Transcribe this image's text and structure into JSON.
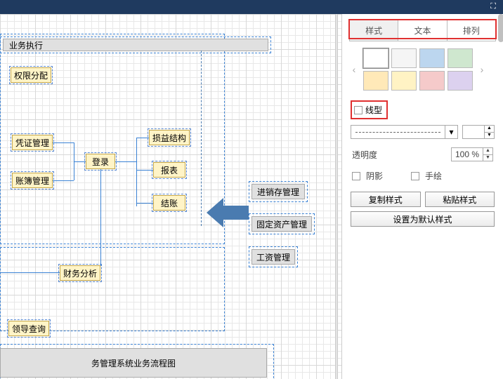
{
  "canvas": {
    "header": "业务执行",
    "nodes": {
      "perm": "权限分配",
      "voucher": "凭证管理",
      "login": "登录",
      "ledger": "账簿管理",
      "pl": "损益结构",
      "report": "报表",
      "closing": "结账",
      "finance": "财务分析",
      "leader": "领导查询"
    },
    "side_boxes": {
      "inventory": "进销存管理",
      "asset": "固定资产管理",
      "salary": "工资管理"
    },
    "footer": "务管理系统业务流程图"
  },
  "panel": {
    "tabs": {
      "style": "样式",
      "text": "文本",
      "arrange": "排列"
    },
    "swatches": [
      "#ffffff",
      "#f5f5f5",
      "#bcd6ef",
      "#cfe7cf",
      "#ffe9b8",
      "#fff3c4",
      "#f5caca",
      "#dcd1ef"
    ],
    "line_type_label": "线型",
    "width_value": "",
    "opacity_label": "透明度",
    "opacity_value": "100 %",
    "shadow_label": "阴影",
    "hand_label": "手绘",
    "copy_style": "复制样式",
    "paste_style": "粘贴样式",
    "set_default": "设置为默认样式"
  }
}
